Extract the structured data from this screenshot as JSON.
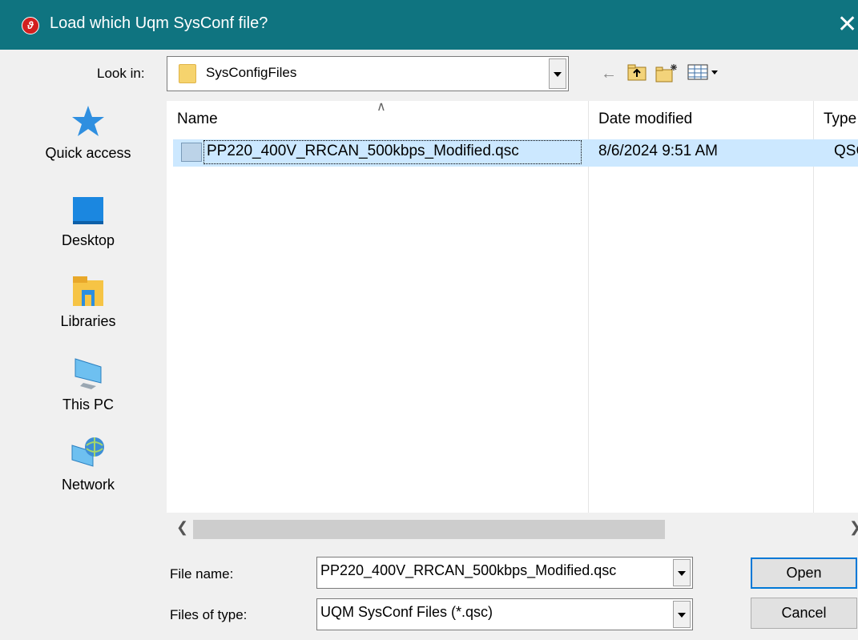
{
  "window": {
    "title": "Load which Uqm SysConf file?",
    "app_icon": "uqm-app-icon",
    "close_glyph": "✕"
  },
  "look_in": {
    "label": "Look in:",
    "value": "SysConfigFiles"
  },
  "toolbar": {
    "back_icon": "back-arrow-icon",
    "up_icon": "up-folder-icon",
    "new_folder_icon": "new-folder-icon",
    "view_menu_icon": "view-menu-icon"
  },
  "places": [
    {
      "label": "Quick access",
      "icon": "star-icon"
    },
    {
      "label": "Desktop",
      "icon": "desktop-icon"
    },
    {
      "label": "Libraries",
      "icon": "libraries-icon"
    },
    {
      "label": "This PC",
      "icon": "computer-icon"
    },
    {
      "label": "Network",
      "icon": "network-icon"
    }
  ],
  "file_list": {
    "columns": [
      "Name",
      "Date modified",
      "Type"
    ],
    "rows": [
      {
        "name": "PP220_400V_RRCAN_500kbps_Modified.qsc",
        "date": "8/6/2024 9:51 AM",
        "type": "QSC"
      }
    ]
  },
  "file_name": {
    "label": "File name:",
    "value": "PP220_400V_RRCAN_500kbps_Modified.qsc"
  },
  "files_of_type": {
    "label": "Files of type:",
    "value": "UQM SysConf Files (*.qsc)"
  },
  "buttons": {
    "open": "Open",
    "cancel": "Cancel"
  },
  "colors": {
    "titlebar": "#0f7480",
    "selection": "#cce8ff",
    "dialog_bg": "#f0f0f0"
  }
}
